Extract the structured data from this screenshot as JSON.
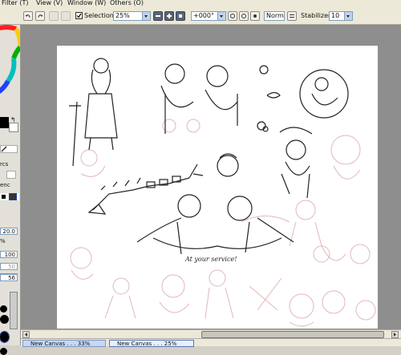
{
  "menu": {
    "filter": "Filter (T)",
    "view": "View (V)",
    "window": "Window (W)",
    "others": "Others (O)"
  },
  "toolbar": {
    "selection_label": "Selection",
    "selection_checked": true,
    "zoom_value": "25%",
    "rotation_value": "+000°",
    "blend_mode": "Normal",
    "stabilizer_label": "Stabilizer",
    "stabilizer_value": "10"
  },
  "left_panel": {
    "size_value": "20.0",
    "value_30": "30",
    "value_50": "50",
    "value_100": "100",
    "value_56": "56",
    "value_56_pct": "56",
    "pct_label": "%",
    "label_rcs": "rcs",
    "label_enc": "enc"
  },
  "canvas": {
    "caption": "At your service!"
  },
  "taskbar": {
    "tabs": [
      {
        "label": "New Canvas . . . 33%",
        "active": false
      },
      {
        "label": "New Canvas . . . 25%",
        "active": true
      }
    ]
  },
  "colors": {
    "primary": "#000000",
    "secondary": "#ffffff",
    "accent": "#2244aa"
  }
}
